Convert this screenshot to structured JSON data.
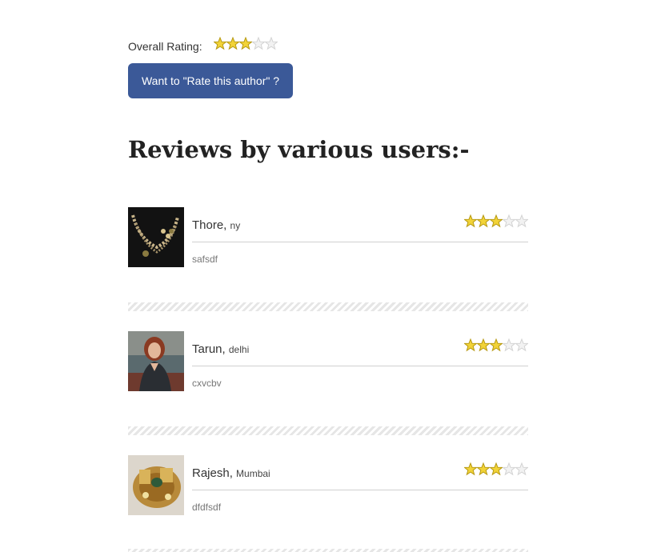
{
  "overall": {
    "label": "Overall Rating:",
    "rating": 3,
    "max": 5
  },
  "rate_button": {
    "label": "Want to \"Rate this author\" ?"
  },
  "reviews_heading": "Reviews by various users:-",
  "reviews": [
    {
      "name": "Thore,",
      "city": "ny",
      "rating": 3,
      "max": 5,
      "text": "safsdf",
      "avatar": "jewelry-necklace-photo"
    },
    {
      "name": "Tarun,",
      "city": "delhi",
      "rating": 3,
      "max": 5,
      "text": "cxvcbv",
      "avatar": "woman-portrait-photo"
    },
    {
      "name": "Rajesh,",
      "city": "Mumbai",
      "rating": 3,
      "max": 5,
      "text": "dfdfsdf",
      "avatar": "gold-ring-photo"
    }
  ],
  "colors": {
    "button_bg": "#3b5998",
    "star_on": "#f2d338",
    "star_off": "#f2f2f2"
  }
}
